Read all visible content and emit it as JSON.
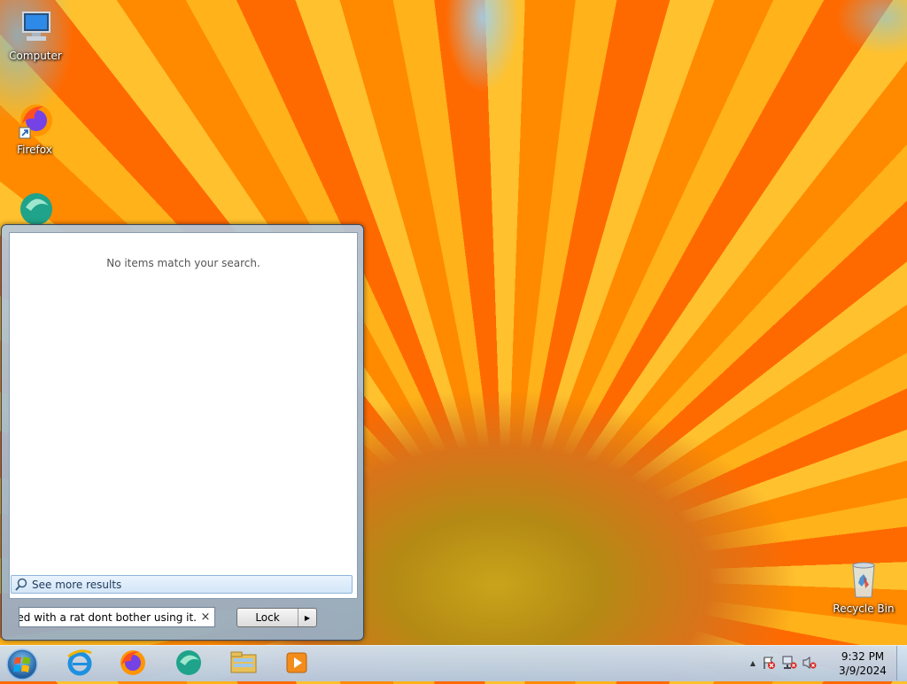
{
  "desktop": {
    "icons": [
      {
        "label": "Computer"
      },
      {
        "label": "Firefox"
      },
      {
        "label": ""
      },
      {
        "label": "Recycle Bin"
      }
    ]
  },
  "start_menu": {
    "no_results_text": "No items match your search.",
    "see_more_label": "See more results",
    "search_value": "infected with a rat dont bother using it.",
    "clear_glyph": "×",
    "lock_label": "Lock",
    "lock_arrow": "▶"
  },
  "taskbar": {
    "pinned": [
      "internet-explorer-icon",
      "firefox-icon",
      "app-icon",
      "file-explorer-icon",
      "media-player-icon"
    ],
    "tray_up_arrow": "▲",
    "clock_time": "9:32 PM",
    "clock_date": "3/9/2024"
  },
  "colors": {
    "wallpaper_orange": "#ff8c00",
    "taskbar": "#c4d5e8",
    "menu_border": "#3a4a5e"
  }
}
